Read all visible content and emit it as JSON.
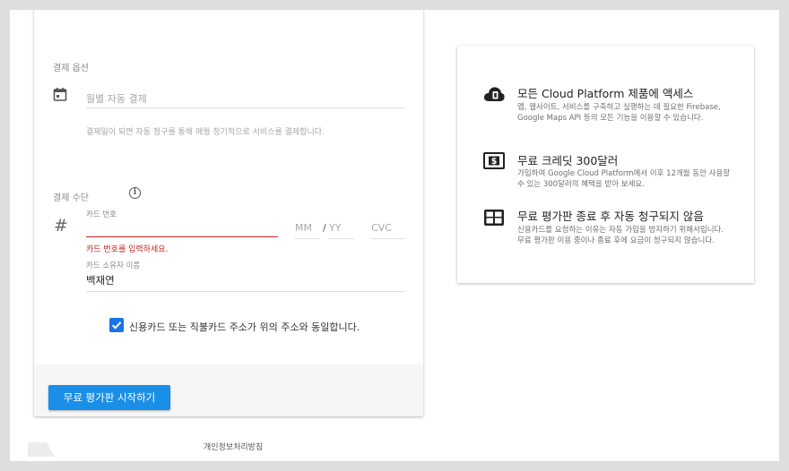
{
  "payment_options": {
    "section_label": "결제 옵션",
    "plan_field_value": "월별 자동 결제",
    "plan_help": "결제일이 되면 자동 청구를 통해 매월 정기적으로 서비스를 결제합니다."
  },
  "payment_method": {
    "section_label": "결제 수단",
    "card_number_label": "카드 번호",
    "card_number_error": "카드 번호를 입력하세요.",
    "month_placeholder": "MM",
    "separator": "/",
    "year_placeholder": "YY",
    "cvc_placeholder": "CVC",
    "cardholder_label": "카드 소유자 이름",
    "cardholder_value": "백재연",
    "same_address_label": "신용카드 또는 직불카드 주소가 위의 주소와 동일합니다.",
    "same_address_checked": true
  },
  "footer": {
    "start_button": "무료 평가판 시작하기",
    "privacy_link": "개인정보처리방침"
  },
  "benefits": [
    {
      "icon": "cloud-icon",
      "title": "모든 Cloud Platform 제품에 액세스",
      "desc": "앱, 웹사이트, 서비스를 구축하고 실행하는 데 필요한 Firebase, Google Maps API 등의 모든 기능을 이용할 수 있습니다."
    },
    {
      "icon": "dollar-bill-icon",
      "title": "무료 크레딧 300달러",
      "desc": "가입하여 Google Cloud Platform에서 이후 12개월 동안 사용할 수 있는 300달러의 혜택을 받아 보세요."
    },
    {
      "icon": "no-autocharge-icon",
      "title": "무료 평가판 종료 후 자동 청구되지 않음",
      "desc": "신용카드를 요청하는 이유는 자동 가입을 방지하기 위해서입니다. 무료 평가판 이용 중이나 종료 후에 요금이 청구되지 않습니다."
    }
  ],
  "colors": {
    "primary_button": "#1a8fe8",
    "checkbox": "#1a73e8",
    "error": "#c5221f"
  }
}
